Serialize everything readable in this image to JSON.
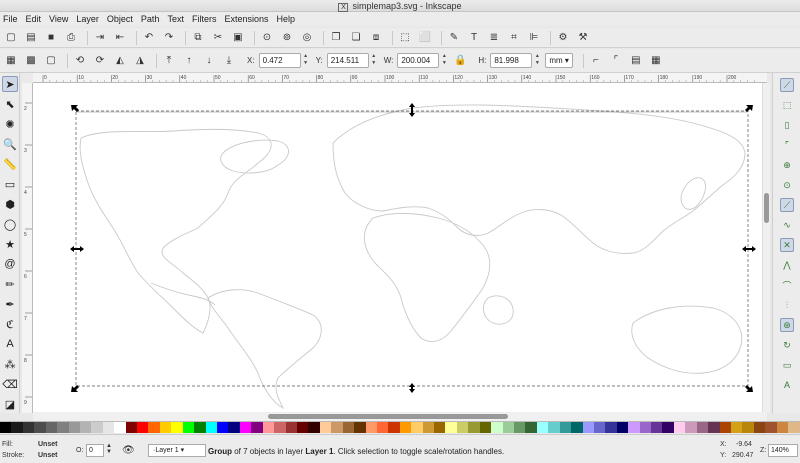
{
  "window": {
    "title": "simplemap3.svg - Inkscape",
    "app_icon": "X"
  },
  "menu": [
    "File",
    "Edit",
    "View",
    "Layer",
    "Object",
    "Path",
    "Text",
    "Filters",
    "Extensions",
    "Help"
  ],
  "commands": [
    {
      "name": "new-icon",
      "glyph": "▢"
    },
    {
      "name": "open-icon",
      "glyph": "▤"
    },
    {
      "name": "save-icon",
      "glyph": "■"
    },
    {
      "name": "print-icon",
      "glyph": "⎙"
    },
    {
      "name": "import-icon",
      "glyph": "⇥"
    },
    {
      "name": "export-icon",
      "glyph": "⇤"
    },
    {
      "name": "undo-icon",
      "glyph": "↶"
    },
    {
      "name": "redo-icon",
      "glyph": "↷"
    },
    {
      "name": "copy-icon",
      "glyph": "⧉"
    },
    {
      "name": "cut-icon",
      "glyph": "✂"
    },
    {
      "name": "paste-icon",
      "glyph": "▣"
    },
    {
      "name": "zoom-selection-icon",
      "glyph": "⊙"
    },
    {
      "name": "zoom-drawing-icon",
      "glyph": "⊚"
    },
    {
      "name": "zoom-page-icon",
      "glyph": "◎"
    },
    {
      "name": "duplicate-icon",
      "glyph": "❐"
    },
    {
      "name": "clone-icon",
      "glyph": "❏"
    },
    {
      "name": "unlink-clone-icon",
      "glyph": "⧈"
    },
    {
      "name": "group-icon",
      "glyph": "⬚"
    },
    {
      "name": "ungroup-icon",
      "glyph": "⬜"
    },
    {
      "name": "fill-stroke-icon",
      "glyph": "✎"
    },
    {
      "name": "text-font-icon",
      "glyph": "T"
    },
    {
      "name": "layers-icon",
      "glyph": "≣"
    },
    {
      "name": "xml-editor-icon",
      "glyph": "⌗"
    },
    {
      "name": "align-icon",
      "glyph": "⊫"
    },
    {
      "name": "document-properties-icon",
      "glyph": "⚙"
    },
    {
      "name": "preferences-icon",
      "glyph": "⚒"
    }
  ],
  "controls": {
    "x_label": "X:",
    "x_value": "0.472",
    "y_label": "Y:",
    "y_value": "214.511",
    "w_label": "W:",
    "w_value": "200.004",
    "h_label": "H:",
    "h_value": "81.998",
    "unit": "mm"
  },
  "tools": [
    {
      "name": "selector-tool-icon",
      "glyph": "➤",
      "active": true
    },
    {
      "name": "node-tool-icon",
      "glyph": "⬉"
    },
    {
      "name": "tweak-tool-icon",
      "glyph": "✺"
    },
    {
      "name": "zoom-tool-icon",
      "glyph": "🔍"
    },
    {
      "name": "measure-tool-icon",
      "glyph": "📏"
    },
    {
      "name": "rectangle-tool-icon",
      "glyph": "▭"
    },
    {
      "name": "3d-box-tool-icon",
      "glyph": "⬢"
    },
    {
      "name": "ellipse-tool-icon",
      "glyph": "◯"
    },
    {
      "name": "star-tool-icon",
      "glyph": "★"
    },
    {
      "name": "spiral-tool-icon",
      "glyph": "@"
    },
    {
      "name": "pencil-tool-icon",
      "glyph": "✏"
    },
    {
      "name": "pen-tool-icon",
      "glyph": "✒"
    },
    {
      "name": "calligraphy-tool-icon",
      "glyph": "ℭ"
    },
    {
      "name": "text-tool-icon",
      "glyph": "A"
    },
    {
      "name": "spray-tool-icon",
      "glyph": "⁂"
    },
    {
      "name": "eraser-tool-icon",
      "glyph": "⌫"
    },
    {
      "name": "bucket-tool-icon",
      "glyph": "◪"
    }
  ],
  "snaps": [
    {
      "name": "snap-toggle-icon",
      "glyph": "⟋",
      "on": true
    },
    {
      "name": "snap-bbox-icon",
      "glyph": "⬚"
    },
    {
      "name": "snap-bbox-edge-icon",
      "glyph": "▯"
    },
    {
      "name": "snap-bbox-corner-icon",
      "glyph": "⌜"
    },
    {
      "name": "snap-bbox-midpoint-icon",
      "glyph": "⊕"
    },
    {
      "name": "snap-bbox-center-icon",
      "glyph": "⊙"
    },
    {
      "name": "snap-nodes-icon",
      "glyph": "⟋",
      "on": true
    },
    {
      "name": "snap-paths-icon",
      "glyph": "∿"
    },
    {
      "name": "snap-intersection-icon",
      "glyph": "✕",
      "on": true
    },
    {
      "name": "snap-cusp-icon",
      "glyph": "⋀"
    },
    {
      "name": "snap-smooth-icon",
      "glyph": "⌒"
    },
    {
      "name": "snap-midpoint-icon",
      "glyph": "⫶"
    },
    {
      "name": "snap-center-icon",
      "glyph": "⊛",
      "on": true
    },
    {
      "name": "snap-rotation-icon",
      "glyph": "↻"
    },
    {
      "name": "snap-page-icon",
      "glyph": "▭"
    },
    {
      "name": "snap-text-baseline-icon",
      "glyph": "A"
    }
  ],
  "palette_colors": [
    "#000000",
    "#1a1a1a",
    "#333333",
    "#4d4d4d",
    "#666666",
    "#808080",
    "#999999",
    "#b3b3b3",
    "#cccccc",
    "#e6e6e6",
    "#ffffff",
    "#800000",
    "#ff0000",
    "#ff6600",
    "#ffcc00",
    "#ffff00",
    "#00ff00",
    "#008000",
    "#00ffff",
    "#0000ff",
    "#000080",
    "#ff00ff",
    "#800080",
    "#ff9999",
    "#cc6666",
    "#993333",
    "#660000",
    "#330000",
    "#ffcc99",
    "#cc9966",
    "#996633",
    "#663300",
    "#ff9966",
    "#ff6633",
    "#cc3300",
    "#ff9900",
    "#ffcc66",
    "#cc9933",
    "#996600",
    "#ffff99",
    "#cccc66",
    "#999933",
    "#666600",
    "#ccffcc",
    "#99cc99",
    "#669966",
    "#336633",
    "#99ffff",
    "#66cccc",
    "#339999",
    "#006666",
    "#9999ff",
    "#6666cc",
    "#333399",
    "#000066",
    "#cc99ff",
    "#9966cc",
    "#663399",
    "#330066",
    "#ffccee",
    "#cc99bb",
    "#996688",
    "#663355",
    "#aa4400",
    "#d4a017",
    "#b8860b",
    "#8b4513",
    "#a0522d",
    "#cd853f",
    "#deb887"
  ],
  "status": {
    "fill_label": "Fill:",
    "fill_value": "Unset",
    "stroke_label": "Stroke:",
    "stroke_value": "Unset",
    "opacity_label": "O:",
    "opacity_value": "0",
    "layer": "·Layer 1",
    "message_b1": "Group",
    "message_t1": " of 7 objects in layer ",
    "message_b2": "Layer 1",
    "message_t2": ". Click selection to toggle scale/rotation handles.",
    "x_label": "X:",
    "x_value": "-9.64",
    "y_label": "Y:",
    "y_value": "290.47",
    "z_label": "Z:",
    "zoom": "140%"
  },
  "ruler": {
    "h_ticks": [
      "0",
      "10",
      "20",
      "30",
      "40",
      "50",
      "60",
      "70",
      "80",
      "90",
      "100",
      "110",
      "120",
      "130",
      "140",
      "150",
      "160",
      "170",
      "180",
      "190",
      "200"
    ],
    "v_ticks": [
      "2",
      "3",
      "4",
      "5",
      "6",
      "7",
      "8",
      "9"
    ]
  }
}
